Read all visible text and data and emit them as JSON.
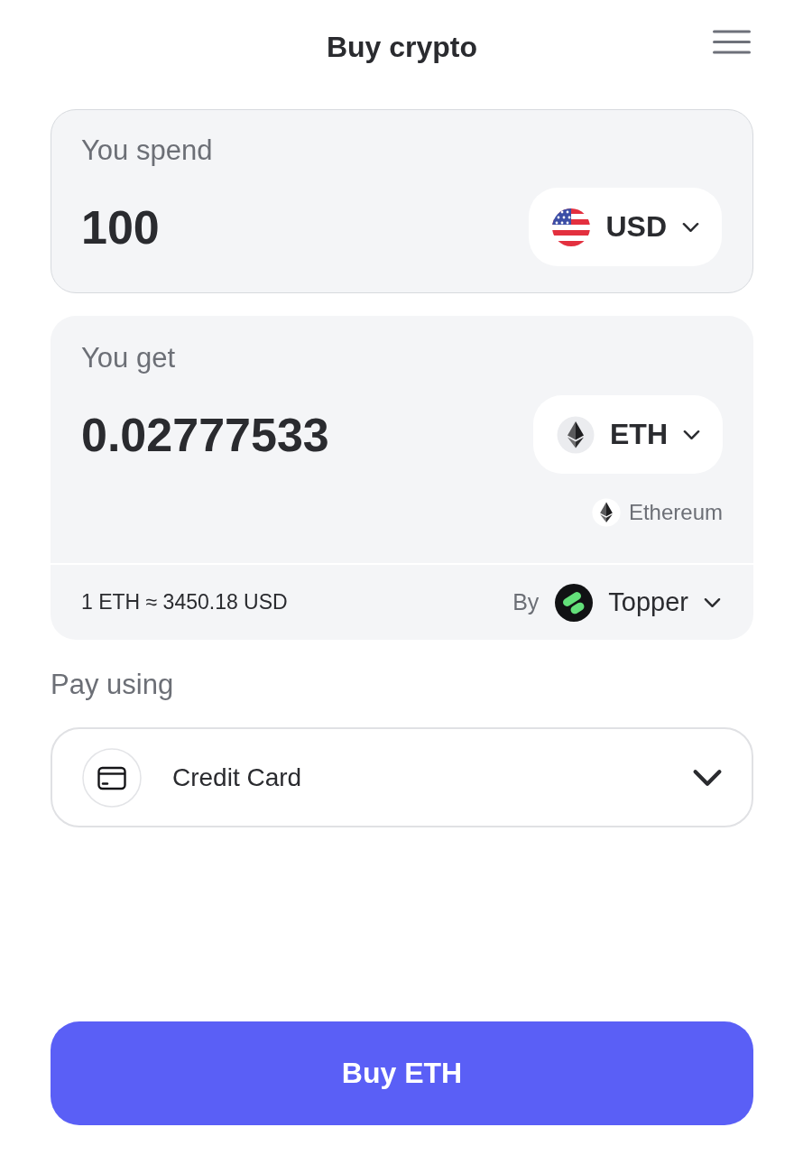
{
  "header": {
    "title": "Buy crypto"
  },
  "spend": {
    "label": "You spend",
    "value": "100",
    "currency": "USD"
  },
  "receive": {
    "label": "You get",
    "value": "0.02777533",
    "currency": "ETH",
    "network": "Ethereum"
  },
  "quote": {
    "rate": "1 ETH ≈ 3450.18 USD",
    "by_label": "By",
    "provider": "Topper"
  },
  "payment": {
    "label": "Pay using",
    "method": "Credit Card"
  },
  "submit": {
    "label": "Buy ETH"
  }
}
